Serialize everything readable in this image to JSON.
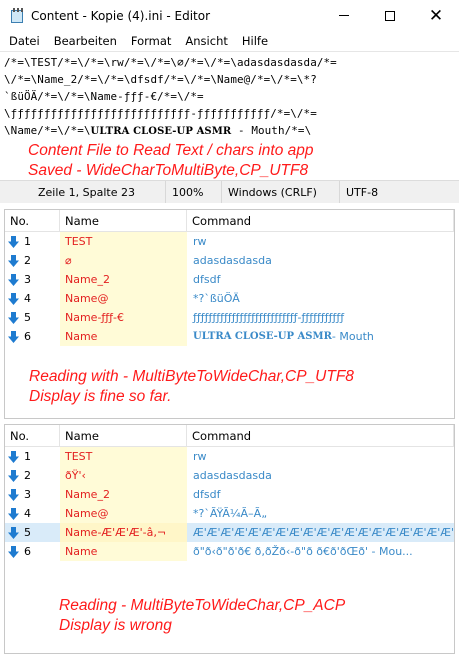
{
  "window": {
    "title": "Content - Kopie (4).ini - Editor",
    "controls": {
      "minimize": "—",
      "maximize": "☐",
      "close": "✕"
    }
  },
  "menu": [
    "Datei",
    "Bearbeiten",
    "Format",
    "Ansicht",
    "Hilfe"
  ],
  "editor": {
    "lines": [
      "/*=\\TEST/*=\\/*=\\rw/*=\\/*=\\⌀/*=\\/*=\\adasdasdasda/*=",
      "\\/*=\\Name_2/*=\\/*=\\dfsdf/*=\\/*=\\Name@/*=\\/*=\\*?",
      "`ßüÖÄ/*=\\/*=\\Name-ƒƒƒ-€/*=\\/*=",
      "\\ƒƒƒƒƒƒƒƒƒƒƒƒƒƒƒƒƒƒƒƒƒƒƒƒƒƒƒ-ƒƒƒƒƒƒƒƒƒƒƒ/*=\\/*=",
      "\\Name/*=\\/*=\\"
    ],
    "line5_bold": "ULTRA CLOSE-UP ASMR",
    "line5_tail": " - Mouth/*=\\",
    "annotation": [
      "Content File to Read Text / chars into app",
      "Saved - WideCharToMultiByte,CP_UTF8"
    ]
  },
  "statusbar": {
    "position": "Zeile 1, Spalte 23",
    "zoom": "100%",
    "line_ending": "Windows (CRLF)",
    "encoding": "UTF-8"
  },
  "list1": {
    "headers": [
      "No.",
      "Name",
      "Command"
    ],
    "rows": [
      {
        "no": "1",
        "name": "TEST",
        "cmd": "rw"
      },
      {
        "no": "2",
        "name": "⌀",
        "cmd": "adasdasdasda"
      },
      {
        "no": "3",
        "name": "Name_2",
        "cmd": "dfsdf"
      },
      {
        "no": "4",
        "name": "Name@",
        "cmd": "*?`ßüÖÄ"
      },
      {
        "no": "5",
        "name": "Name-ƒƒƒ-€",
        "cmd": "ƒƒƒƒƒƒƒƒƒƒƒƒƒƒƒƒƒƒƒƒƒƒƒƒƒƒƒ-ƒƒƒƒƒƒƒƒƒƒƒ"
      },
      {
        "no": "6",
        "name": "Name",
        "cmd_bold": "ULTRA CLOSE-UP ASMR",
        "cmd": " - Mouth"
      }
    ],
    "annotation": [
      "Reading with - MultiByteToWideChar,CP_UTF8",
      "Display is fine so far."
    ]
  },
  "list2": {
    "headers": [
      "No.",
      "Name",
      "Command"
    ],
    "rows": [
      {
        "no": "1",
        "name": "TEST",
        "cmd": "rw"
      },
      {
        "no": "2",
        "name": "ðŸ'‹",
        "cmd": "adasdasdasda"
      },
      {
        "no": "3",
        "name": "Name_2",
        "cmd": "dfsdf"
      },
      {
        "no": "4",
        "name": "Name@",
        "cmd": "*?`ÃŸÃ¼Ã–Ã„"
      },
      {
        "no": "5",
        "name": "Name-Æ'Æ'Æ'-â‚¬",
        "cmd": "Æ'Æ'Æ'Æ'Æ'Æ'Æ'Æ'Æ'Æ'Æ'Æ'Æ'Æ'Æ'Æ'Æ'Æ'Æ'Æ'Æ..."
      },
      {
        "no": "6",
        "name": "Name",
        "cmd": "ð\"ð‹ð\"ð'ð€ ð‚ðŽð‹-ð\"ð ð€ð'ðŒð' - Mou..."
      }
    ],
    "selected_row": 5,
    "annotation": [
      "Reading - MultiByteToWideChar,CP_ACP",
      "Display is wrong"
    ]
  },
  "colors": {
    "accent": "#1e7bd0",
    "annotation": "#ff1a1a",
    "name_column": "#fffbd7",
    "selection": "#d9ebf9"
  }
}
